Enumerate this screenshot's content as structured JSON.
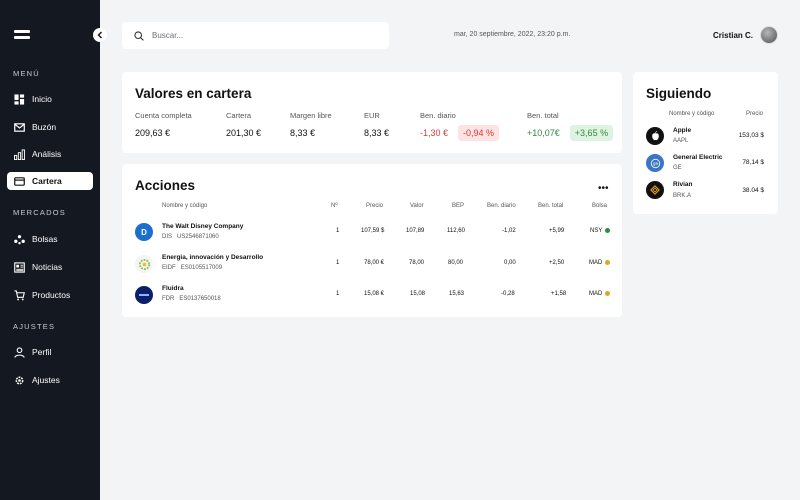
{
  "sidebar": {
    "sections": [
      {
        "label": "MENÚ"
      },
      {
        "label": "MERCADOS"
      },
      {
        "label": "AJUSTES"
      }
    ],
    "items": [
      {
        "label": "Inicio",
        "icon": "grid-icon"
      },
      {
        "label": "Buzón",
        "icon": "mail-icon"
      },
      {
        "label": "Análisis",
        "icon": "bar-chart-icon"
      },
      {
        "label": "Cartera",
        "icon": "wallet-icon",
        "active": true
      },
      {
        "label": "Bolsas",
        "icon": "nodes-icon"
      },
      {
        "label": "Noticias",
        "icon": "newspaper-icon"
      },
      {
        "label": "Productos",
        "icon": "cart-icon"
      },
      {
        "label": "Perfil",
        "icon": "user-icon"
      },
      {
        "label": "Ajustes",
        "icon": "gear-icon"
      }
    ]
  },
  "header": {
    "search_placeholder": "Buscar...",
    "datetime": "mar, 20 septiembre, 2022, 23:20 p.m.",
    "user_name": "Cristian C."
  },
  "portfolio": {
    "title": "Valores en cartera",
    "metrics": [
      {
        "label": "Cuenta completa",
        "value": "209,63 €"
      },
      {
        "label": "Cartera",
        "value": "201,30 €"
      },
      {
        "label": "Margen libre",
        "value": "8,33 €"
      },
      {
        "label": "EUR",
        "value": "8,33 €"
      },
      {
        "label": "Ben. diario",
        "value": "-1,30 €",
        "pill": "-0,94 %"
      },
      {
        "label": "Ben. total",
        "value": "+10,07€",
        "pill": "+3,65 %"
      }
    ]
  },
  "stocks": {
    "title": "Acciones",
    "more_icon": "more-horizontal-icon",
    "headers": [
      "Nombre y código",
      "Nº",
      "Precio",
      "Valor",
      "BEP",
      "Ben. diario",
      "Ben. total",
      "Bolsa"
    ],
    "rows": [
      {
        "name": "The Walt Disney Company",
        "ticker": "DIS",
        "isin": "US2546871060",
        "qty": "1",
        "price": "107,59 $",
        "value": "107,89",
        "bep": "112,60",
        "daily": "-1,02",
        "total": "+5,99",
        "market": "NSY",
        "market_color": "#2f8a3e",
        "logo": "disney-logo",
        "logo_color": "#1b6fd1"
      },
      {
        "name": "Energia, innovación y Desarrollo",
        "ticker": "EIDF",
        "isin": "ES0105517009",
        "qty": "1",
        "price": "78,00 €",
        "value": "78,00",
        "bep": "80,00",
        "daily": "0,00",
        "total": "+2,50",
        "market": "MAD",
        "market_color": "#e0a526",
        "logo": "eidf-logo",
        "logo_color": "#f4f4f4"
      },
      {
        "name": "Fluidra",
        "ticker": "FDR",
        "isin": "ES0137650018",
        "qty": "1",
        "price": "15,08 €",
        "value": "15,08",
        "bep": "15,63",
        "daily": "-0,28",
        "total": "+1,58",
        "market": "MAD",
        "market_color": "#e0a526",
        "logo": "fluidra-logo",
        "logo_color": "#0b1f6b"
      }
    ]
  },
  "following": {
    "title": "Siguiendo",
    "headers": [
      "Nombre y código",
      "Precio"
    ],
    "items": [
      {
        "name": "Apple",
        "ticker": "AAPL",
        "price": "153,03 $",
        "logo": "apple-logo",
        "logo_color": "#111111"
      },
      {
        "name": "General Electric",
        "ticker": "GE",
        "price": "78,14 $",
        "logo": "ge-logo",
        "logo_color": "#3a76c4"
      },
      {
        "name": "Rivian",
        "ticker": "BRK.A",
        "price": "38.04 $",
        "logo": "rivian-logo",
        "logo_color": "#111111"
      }
    ]
  }
}
